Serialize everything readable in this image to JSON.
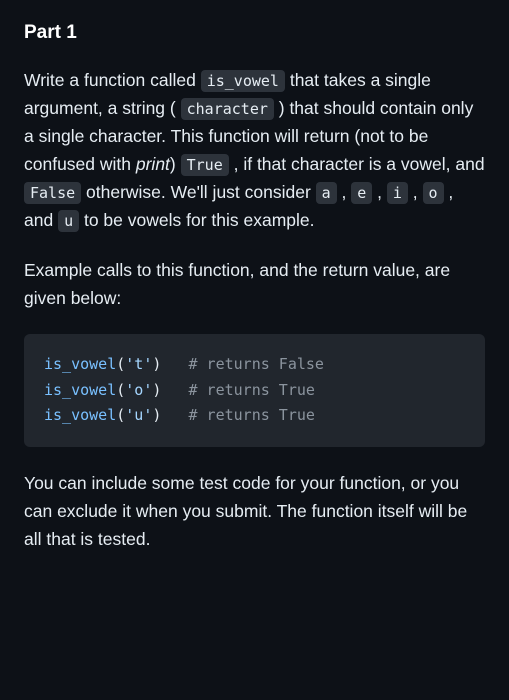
{
  "heading": "Part 1",
  "paragraph1": {
    "t1": "Write a function called ",
    "c1": "is_vowel",
    "t2": " that takes a single argument, a string ( ",
    "c2": "character",
    "t3": " ) that should contain only a single character. This function will return (not to be confused with ",
    "em1": "print",
    "t4": ") ",
    "c3": "True",
    "t5": " , if that character is a vowel, and ",
    "c4": "False",
    "t6": " otherwise. We'll just consider ",
    "c5": "a",
    "t7": " , ",
    "c6": "e",
    "t8": " , ",
    "c7": "i",
    "t9": " , ",
    "c8": "o",
    "t10": " , and ",
    "c9": "u",
    "t11": " to be vowels for this example."
  },
  "paragraph2": "Example calls to this function, and the return value, are given below:",
  "code": {
    "lines": [
      {
        "fn": "is_vowel",
        "open": "(",
        "str": "'t'",
        "close": ")",
        "pad": "   ",
        "comment": "# returns False"
      },
      {
        "fn": "is_vowel",
        "open": "(",
        "str": "'o'",
        "close": ")",
        "pad": "   ",
        "comment": "# returns True"
      },
      {
        "fn": "is_vowel",
        "open": "(",
        "str": "'u'",
        "close": ")",
        "pad": "   ",
        "comment": "# returns True"
      }
    ]
  },
  "paragraph3": "You can include some test code for your function, or you can exclude it when you submit. The function itself will be all that is tested."
}
